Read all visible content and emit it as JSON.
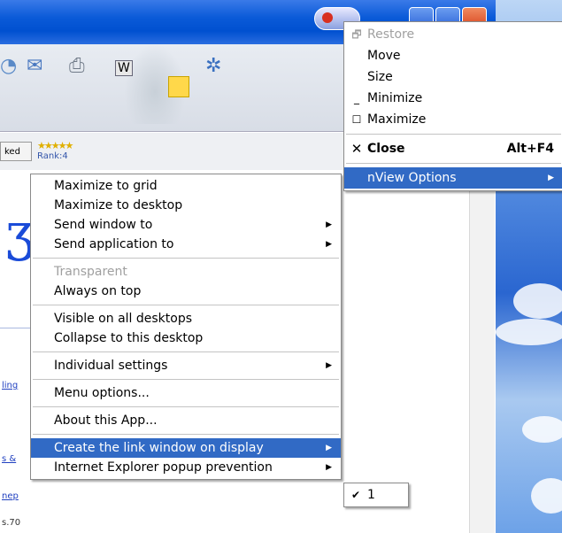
{
  "window": {
    "rank_label": "Rank:4",
    "tab_fragment": "ked",
    "left_fragments": [
      "ling",
      "s &",
      "nep",
      "s.70"
    ]
  },
  "main_menu": {
    "items": [
      {
        "label": "Maximize to grid",
        "submenu": false,
        "disabled": false,
        "selected": false
      },
      {
        "label": "Maximize to desktop",
        "submenu": false,
        "disabled": false,
        "selected": false
      },
      {
        "label": "Send window to",
        "submenu": true,
        "disabled": false,
        "selected": false
      },
      {
        "label": "Send application to",
        "submenu": true,
        "disabled": false,
        "selected": false
      },
      {
        "separator": true
      },
      {
        "label": "Transparent",
        "submenu": false,
        "disabled": true,
        "selected": false
      },
      {
        "label": "Always on top",
        "submenu": false,
        "disabled": false,
        "selected": false
      },
      {
        "separator": true
      },
      {
        "label": "Visible on all desktops",
        "submenu": false,
        "disabled": false,
        "selected": false
      },
      {
        "label": "Collapse to this desktop",
        "submenu": false,
        "disabled": false,
        "selected": false
      },
      {
        "separator": true
      },
      {
        "label": "Individual settings",
        "submenu": true,
        "disabled": false,
        "selected": false
      },
      {
        "separator": true
      },
      {
        "label": "Menu options...",
        "submenu": false,
        "disabled": false,
        "selected": false
      },
      {
        "separator": true
      },
      {
        "label": "About this App...",
        "submenu": false,
        "disabled": false,
        "selected": false
      },
      {
        "separator": true
      },
      {
        "label": "Create the link window on display",
        "submenu": true,
        "disabled": false,
        "selected": true
      },
      {
        "label": "Internet Explorer popup prevention",
        "submenu": true,
        "disabled": false,
        "selected": false
      }
    ]
  },
  "system_menu": {
    "items": [
      {
        "label": "Restore",
        "icon": "restore-icon",
        "disabled": true
      },
      {
        "label": "Move",
        "icon": "",
        "disabled": false
      },
      {
        "label": "Size",
        "icon": "",
        "disabled": false
      },
      {
        "label": "Minimize",
        "icon": "minimize-icon",
        "disabled": false
      },
      {
        "label": "Maximize",
        "icon": "maximize-icon",
        "disabled": false
      },
      {
        "separator": true
      },
      {
        "label": "Close",
        "icon": "close-icon",
        "shortcut": "Alt+F4",
        "bold": true,
        "disabled": false
      },
      {
        "separator": true
      },
      {
        "label": "nView Options",
        "icon": "",
        "submenu": true,
        "selected": true,
        "disabled": false
      }
    ]
  },
  "display_submenu": {
    "items": [
      {
        "label": "1",
        "checked": true
      }
    ]
  },
  "colors": {
    "menu_highlight": "#316ac5",
    "titlebar": "#0a5ad8"
  }
}
